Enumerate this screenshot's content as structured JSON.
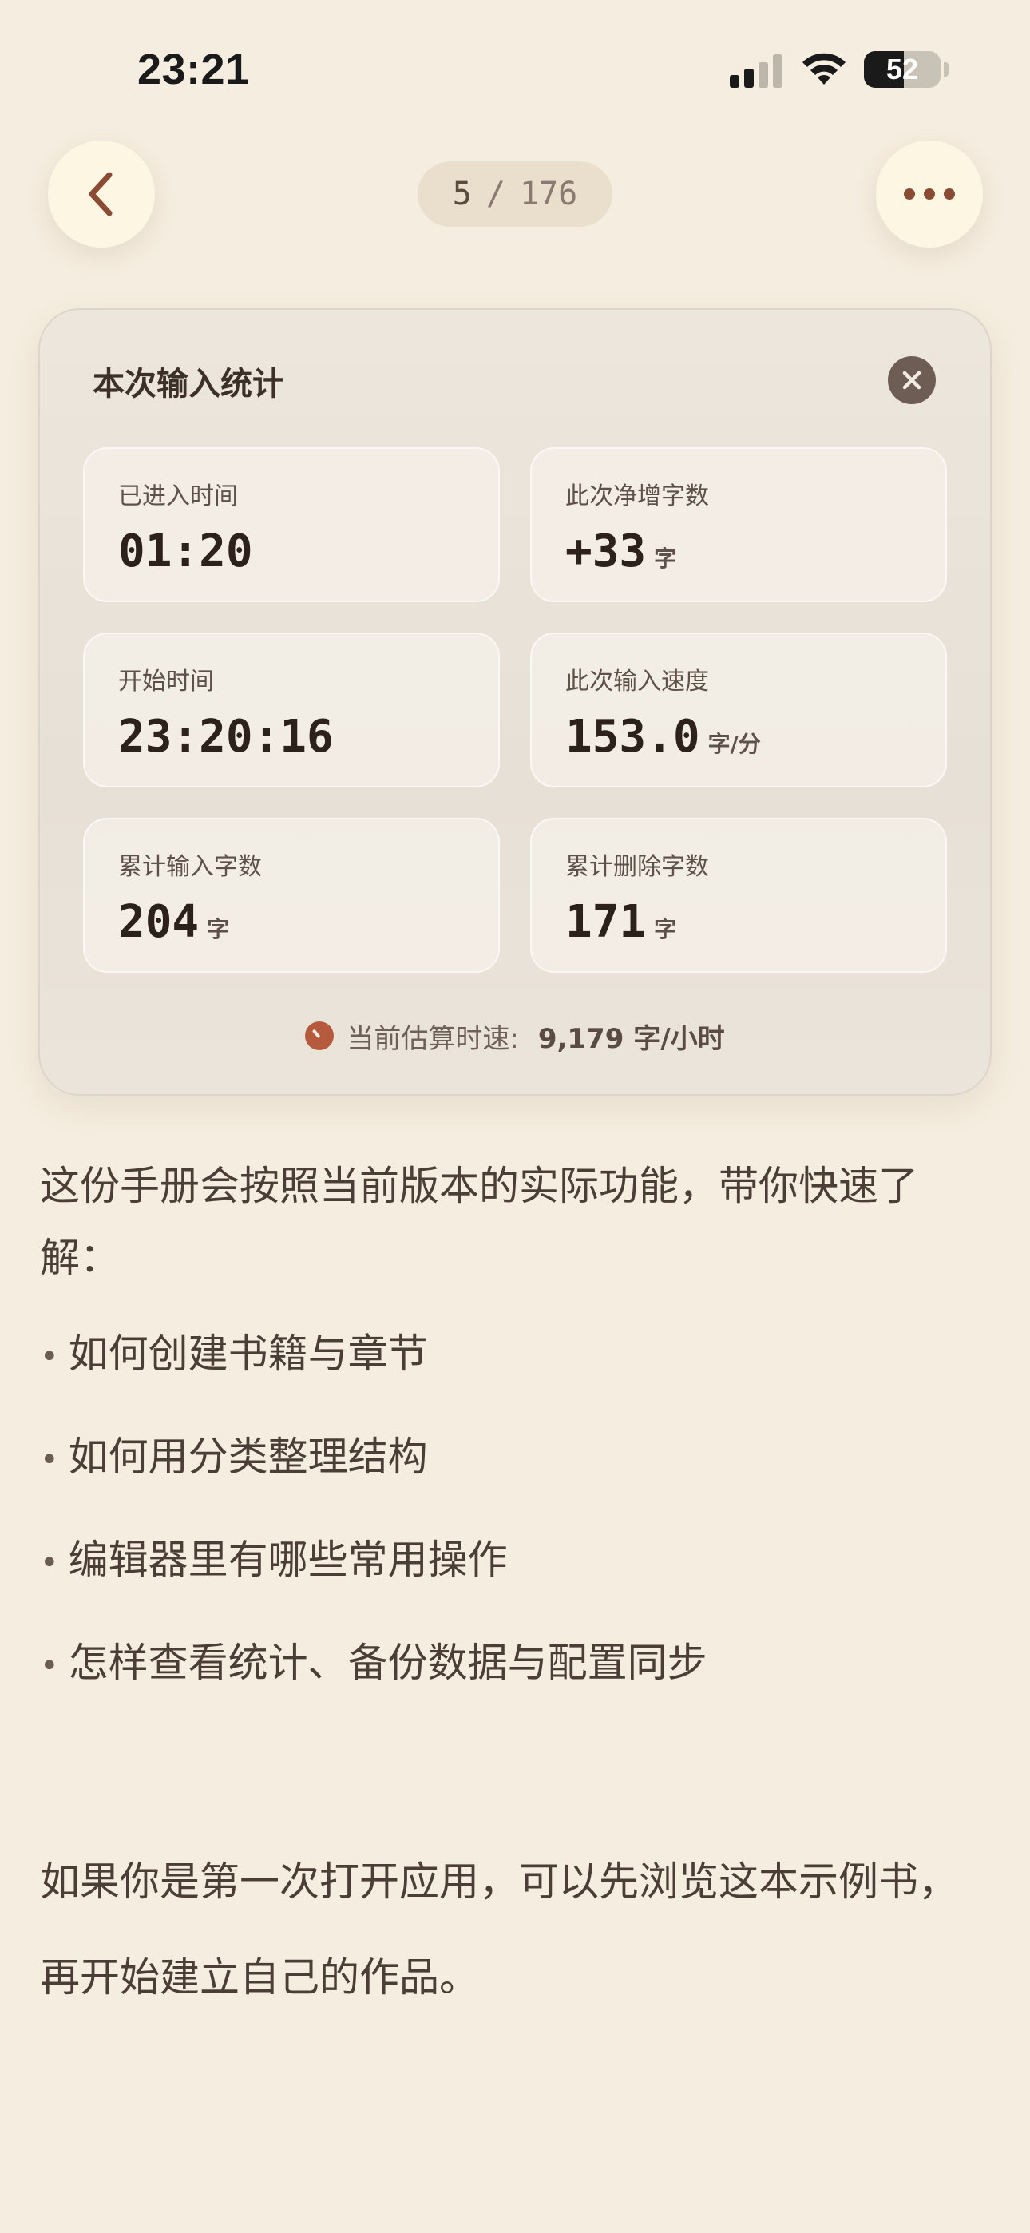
{
  "status_bar": {
    "time": "23:21",
    "battery_level": "52",
    "battery_fraction": 0.52
  },
  "nav": {
    "current_page": "5",
    "separator": "/",
    "total_pages": "176",
    "back_icon": "chevron-left-icon",
    "more_icon": "ellipsis-icon"
  },
  "stats_card": {
    "title": "本次输入统计",
    "close_icon": "close-icon",
    "tiles": [
      {
        "label": "已进入时间",
        "value": "01:20",
        "unit": ""
      },
      {
        "label": "此次净增字数",
        "value": "+33",
        "unit": "字"
      },
      {
        "label": "开始时间",
        "value": "23:20:16",
        "unit": ""
      },
      {
        "label": "此次输入速度",
        "value": "153.0",
        "unit": "字/分"
      },
      {
        "label": "累计输入字数",
        "value": "204",
        "unit": "字"
      },
      {
        "label": "累计删除字数",
        "value": "171",
        "unit": "字"
      }
    ],
    "estimate_label": "当前估算时速:",
    "estimate_value": "9,179 字/小时"
  },
  "content": {
    "intro": "这份手册会按照当前版本的实际功能，带你快速了解：",
    "bullet_marker": "•",
    "bullets": [
      "如何创建书籍与章节",
      "如何用分类整理结构",
      "编辑器里有哪些常用操作",
      "怎样查看统计、备份数据与配置同步"
    ],
    "closing": "如果你是第一次打开应用，可以先浏览这本示例书，再开始建立自己的作品。"
  },
  "colors": {
    "background": "#f5eddf",
    "accent": "#8b4a33",
    "estimate_icon": "#b65a3e",
    "close_button": "#6e5d55"
  }
}
